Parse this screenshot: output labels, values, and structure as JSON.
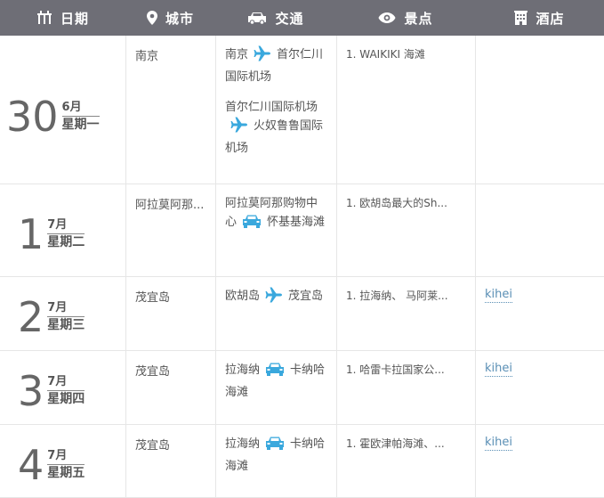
{
  "header": {
    "date_label": "日期",
    "city_label": "城市",
    "transport_label": "交通",
    "spot_label": "景点",
    "hotel_label": "酒店"
  },
  "days": [
    {
      "day": "30",
      "month": "6月",
      "weekday": "星期一",
      "city": "南京",
      "transport": [
        {
          "from": "南京",
          "mode": "plane-icon",
          "to": "首尔仁川国际机场"
        },
        {
          "from": "首尔仁川国际机场",
          "mode": "plane-icon",
          "to": "火奴鲁鲁国际机场"
        }
      ],
      "spot": "1. WAIKIKI 海滩",
      "hotel": ""
    },
    {
      "day": "1",
      "month": "7月",
      "weekday": "星期二",
      "city": "阿拉莫阿那...",
      "transport": [
        {
          "from": "阿拉莫阿那购物中心",
          "mode": "car-icon",
          "to": "怀基基海滩"
        }
      ],
      "spot": "1. 欧胡岛最大的Sh...",
      "hotel": ""
    },
    {
      "day": "2",
      "month": "7月",
      "weekday": "星期三",
      "city": "茂宜岛",
      "transport": [
        {
          "from": "欧胡岛",
          "mode": "plane-icon",
          "to": "茂宜岛"
        }
      ],
      "spot": "1. 拉海纳、 马阿莱...",
      "hotel": "kihei"
    },
    {
      "day": "3",
      "month": "7月",
      "weekday": "星期四",
      "city": "茂宜岛",
      "transport": [
        {
          "from": "拉海纳",
          "mode": "car-icon",
          "to": "卡纳哈海滩"
        }
      ],
      "spot": "1. 哈雷卡拉国家公...",
      "hotel": "kihei"
    },
    {
      "day": "4",
      "month": "7月",
      "weekday": "星期五",
      "city": "茂宜岛",
      "transport": [
        {
          "from": "拉海纳",
          "mode": "car-icon",
          "to": "卡纳哈海滩"
        }
      ],
      "spot": "1. 霍欧津帕海滩、...",
      "hotel": "kihei"
    }
  ],
  "colors": {
    "header_bg": "#6e6e76",
    "icon_blue": "#3aa8dd",
    "link": "#5a8fb5",
    "border": "#e6e6e6"
  }
}
